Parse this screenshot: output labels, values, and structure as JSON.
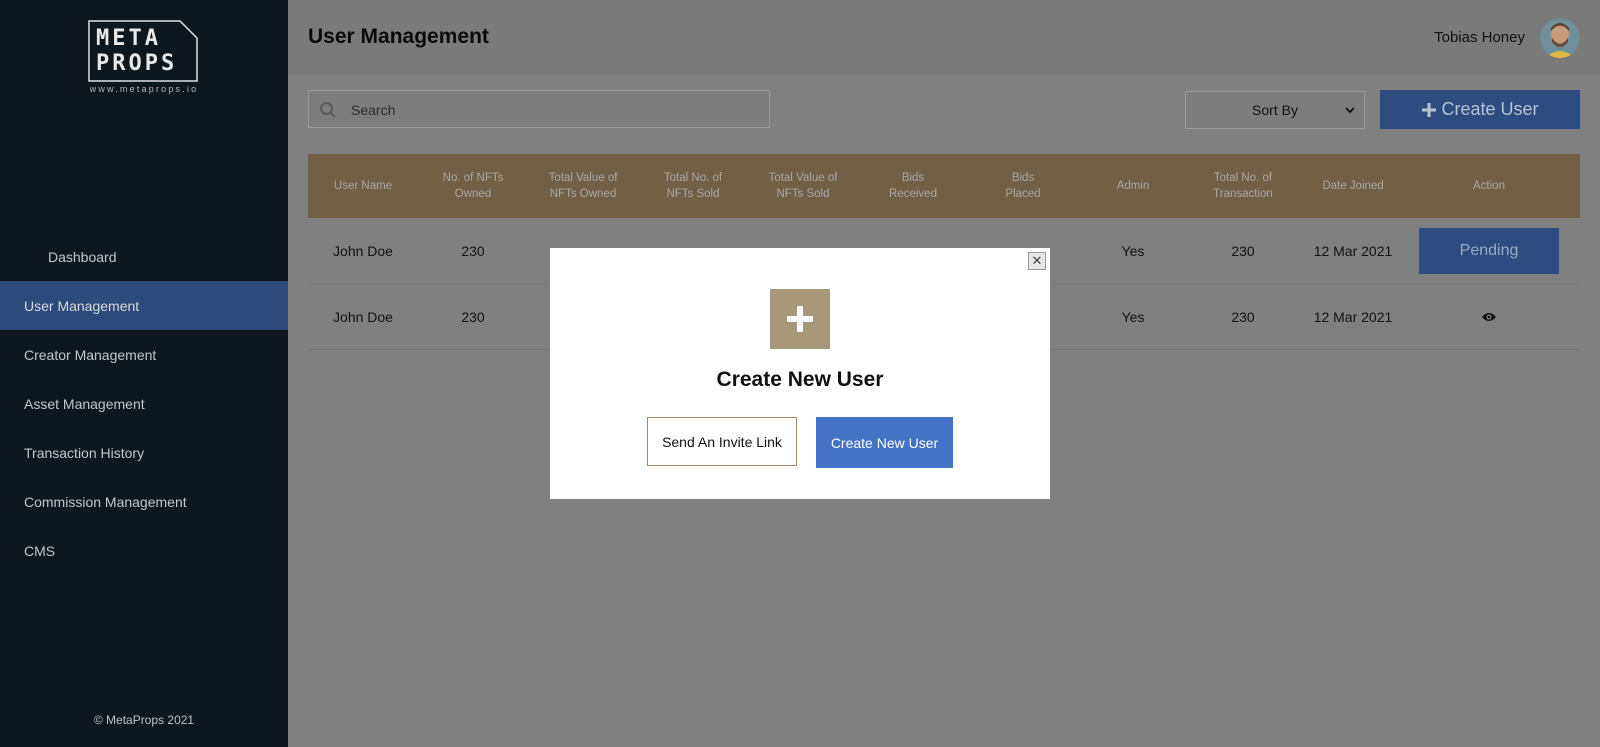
{
  "brand": {
    "logo_line1": "META",
    "logo_line2": "PROPS",
    "url": "www.metaprops.io"
  },
  "sidebar": {
    "items": [
      {
        "label": "Dashboard",
        "active": false
      },
      {
        "label": "User Management",
        "active": true
      },
      {
        "label": "Creator Management",
        "active": false
      },
      {
        "label": "Asset Management",
        "active": false
      },
      {
        "label": "Transaction History",
        "active": false
      },
      {
        "label": "Commission Management",
        "active": false
      },
      {
        "label": "CMS",
        "active": false
      }
    ],
    "footer": "© MetaProps 2021"
  },
  "header": {
    "title": "User Management",
    "user_name": "Tobias Honey"
  },
  "toolbar": {
    "search_placeholder": "Search",
    "sort_label": "Sort By",
    "create_label": "Create User"
  },
  "table": {
    "columns": [
      [
        "User Name"
      ],
      [
        "No. of NFTs",
        "Owned"
      ],
      [
        "Total Value of",
        "NFTs Owned"
      ],
      [
        "Total No. of",
        "NFTs Sold"
      ],
      [
        "Total Value of",
        "NFTs Sold"
      ],
      [
        "Bids",
        "Received"
      ],
      [
        "Bids",
        "Placed"
      ],
      [
        "Admin"
      ],
      [
        "Total No. of",
        "Transaction"
      ],
      [
        "Date Joined"
      ],
      [
        "Action"
      ]
    ],
    "rows": [
      {
        "user_name": "John Doe",
        "nfts_owned": "230",
        "admin": "Yes",
        "transactions": "230",
        "date_joined": "12 Mar 2021",
        "action": "Pending"
      },
      {
        "user_name": "John Doe",
        "nfts_owned": "230",
        "admin": "Yes",
        "transactions": "230",
        "date_joined": "12 Mar 2021",
        "action": "view-icon"
      }
    ]
  },
  "modal": {
    "title": "Create New User",
    "invite_label": "Send An Invite Link",
    "create_label": "Create New User",
    "close_icon": "close-icon",
    "plus_icon": "plus-icon"
  },
  "colors": {
    "sidebar_bg": "#0e171d",
    "active_nav": "#2d4a7b",
    "table_header": "#735f45",
    "primary_button": "#4472c4",
    "accent_tan": "#a8977b"
  }
}
